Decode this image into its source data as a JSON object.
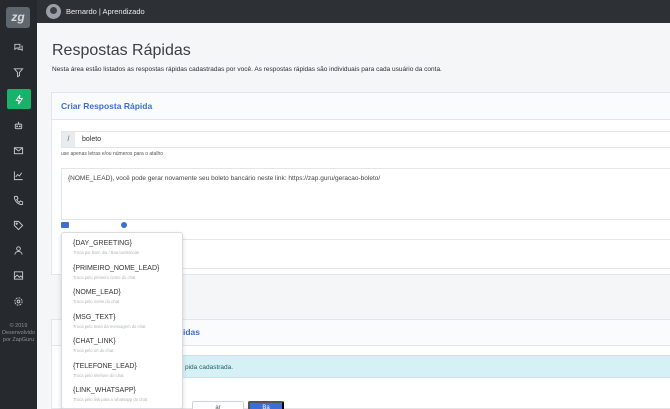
{
  "sidebar": {
    "logo": "zg",
    "icons": [
      "chats-icon",
      "funnel-icon",
      "flash-icon",
      "bot-icon",
      "email-icon",
      "chart-icon",
      "phone-icon",
      "tag-icon",
      "user-icon",
      "image-icon",
      "settings-icon"
    ],
    "active": "flash-icon",
    "footer": [
      "© 2019",
      "Desenvolvido",
      "por ZapGuru"
    ]
  },
  "topbar": {
    "user": "Bernardo | Aprendizado"
  },
  "page": {
    "title": "Respostas Rápidas",
    "description": "Nesta área estão listados as respostas rápidas cadastradas por você. As respostas rápidas são individuais para cada usuário da conta."
  },
  "create_card": {
    "title": "Criar Resposta Rápida",
    "shortcut_prefix": "/",
    "shortcut_value": "boleto",
    "help": "use apenas letras e/ou números para o atalho",
    "message": "{NOME_LEAD}, você pode gerar novamente seu boleto bancário neste link: https://zap.guru/geracao-boleto/"
  },
  "variables": [
    {
      "label": "{DAY_GREETING}",
      "hint": "Troca por Bom dia / Boa tarde/noite"
    },
    {
      "label": "{PRIMEIRO_NOME_LEAD}",
      "hint": "Troca pelo primeiro nome do chat"
    },
    {
      "label": "{NOME_LEAD}",
      "hint": "Troca pelo nome do chat"
    },
    {
      "label": "{MSG_TEXT}",
      "hint": "Troca pelo texto da mensagem do chat"
    },
    {
      "label": "{CHAT_LINK}",
      "hint": "Troca pelo url do chat"
    },
    {
      "label": "{TELEFONE_LEAD}",
      "hint": "Troca pelo telefone do chat"
    },
    {
      "label": "{LINK_WHATSAPP}",
      "hint": "Troca pelo link para o whatsapp do chat"
    }
  ],
  "list_card": {
    "title_fragment": "idas",
    "alert_fragment": "pida cadastrada.",
    "btn_outline_fragment": "ar",
    "btn_primary_fragment": "Ba"
  },
  "colors": {
    "accent": "#3c6fd6",
    "active": "#18b26b",
    "sidebar": "#262a2f"
  }
}
